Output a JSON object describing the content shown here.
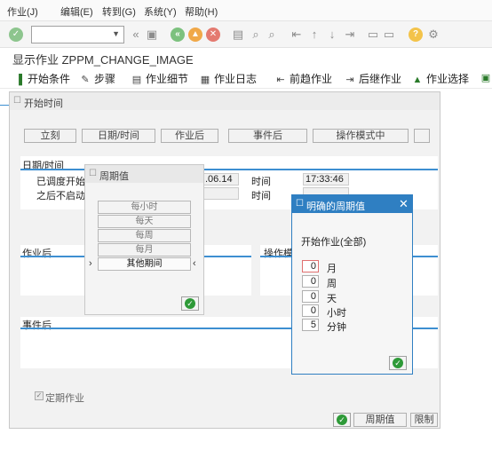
{
  "menubar": {
    "items": [
      "作业(J)",
      "编辑(E)",
      "转到(G)",
      "系统(Y)",
      "帮助(H)"
    ]
  },
  "toolbar": {
    "command_value": ""
  },
  "title": "显示作业 ZPPM_CHANGE_IMAGE",
  "app_toolbar": {
    "buttons": [
      "开始条件",
      "步骤",
      "作业细节",
      "作业日志",
      "前趋作业",
      "后继作业",
      "作业选择"
    ]
  },
  "start_dialog": {
    "title": "开始时间",
    "buttons": [
      "立刻",
      "日期/时间",
      "作业后",
      "事件后",
      "操作模式中"
    ],
    "datetime_group": "日期/时间",
    "scheduled_start_label": "已调度开始",
    "scheduled_date_value": ".06.14",
    "time_label_1": "时间",
    "time_value_1": "17:33:46",
    "no_start_after_label": "之后不启动",
    "time_label_2": "时间",
    "after_job_group": "作业后",
    "op_mode_group": "操作模式",
    "after_event_group": "事件后",
    "periodic_checkbox_label": "定期作业",
    "bottom_buttons": [
      "周期值",
      "限制"
    ]
  },
  "period_dialog": {
    "title": "周期值",
    "options": [
      "每小时",
      "每天",
      "每周",
      "每月",
      "其他期间"
    ]
  },
  "explicit_dialog": {
    "title": "明确的周期值",
    "subtitle": "开始作业(全部)",
    "rows": [
      {
        "value": "0",
        "unit": "月"
      },
      {
        "value": "0",
        "unit": "周"
      },
      {
        "value": "0",
        "unit": "天"
      },
      {
        "value": "0",
        "unit": "小时"
      },
      {
        "value": "5",
        "unit": "分钟"
      }
    ],
    "close_symbol": "✕"
  }
}
